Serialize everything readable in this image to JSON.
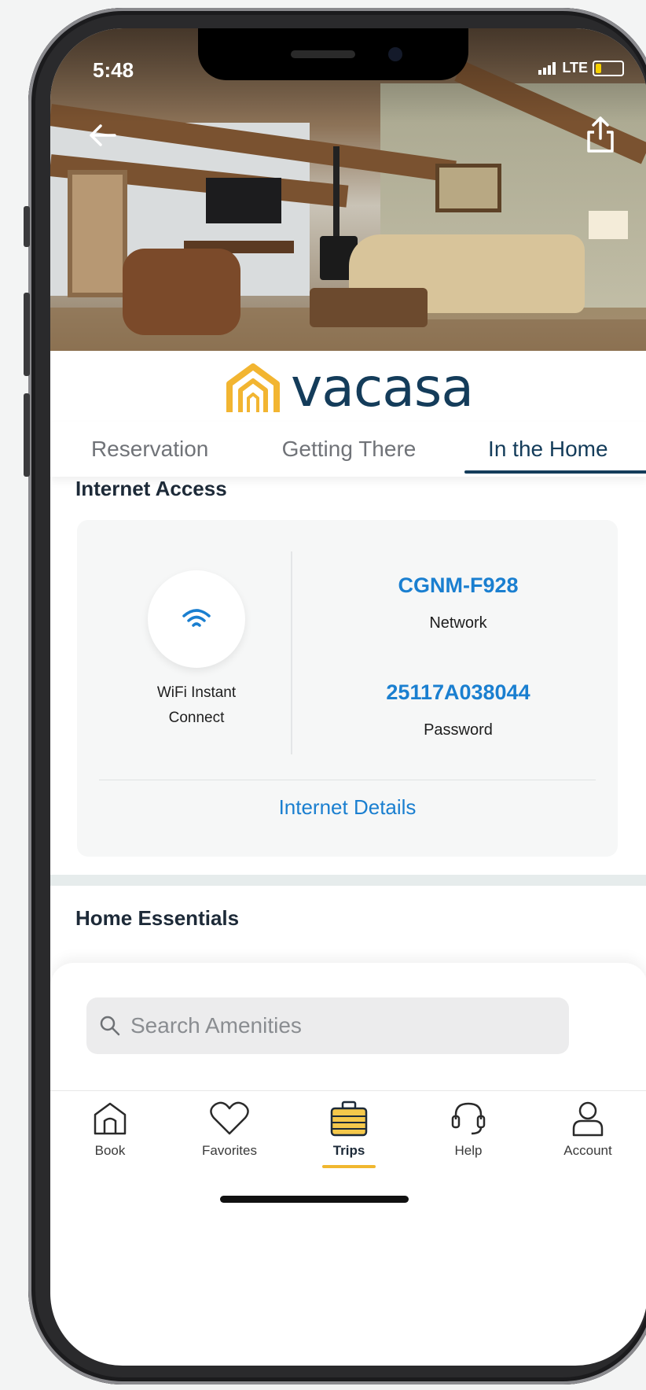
{
  "status_bar": {
    "time": "5:48",
    "carrier": "LTE"
  },
  "brand": {
    "name": "vacasa"
  },
  "tabs": [
    {
      "label": "Reservation",
      "active": false
    },
    {
      "label": "Getting There",
      "active": false
    },
    {
      "label": "In the Home",
      "active": true
    }
  ],
  "internet": {
    "title": "Internet Access",
    "instant_connect_label_line1": "WiFi Instant",
    "instant_connect_label_line2": "Connect",
    "network_value": "CGNM-F928",
    "network_label": "Network",
    "password_value": "25117A038044",
    "password_label": "Password",
    "details_link": "Internet Details"
  },
  "essentials": {
    "title": "Home Essentials",
    "search_placeholder": "Search Amenities"
  },
  "bottom_nav": [
    {
      "label": "Book",
      "icon": "house-icon",
      "active": false
    },
    {
      "label": "Favorites",
      "icon": "heart-icon",
      "active": false
    },
    {
      "label": "Trips",
      "icon": "suitcase-icon",
      "active": true
    },
    {
      "label": "Help",
      "icon": "headset-icon",
      "active": false
    },
    {
      "label": "Account",
      "icon": "person-icon",
      "active": false
    }
  ],
  "colors": {
    "brand_navy": "#143c5a",
    "link_blue": "#1a7fd0",
    "accent_yellow": "#f0b72f"
  }
}
